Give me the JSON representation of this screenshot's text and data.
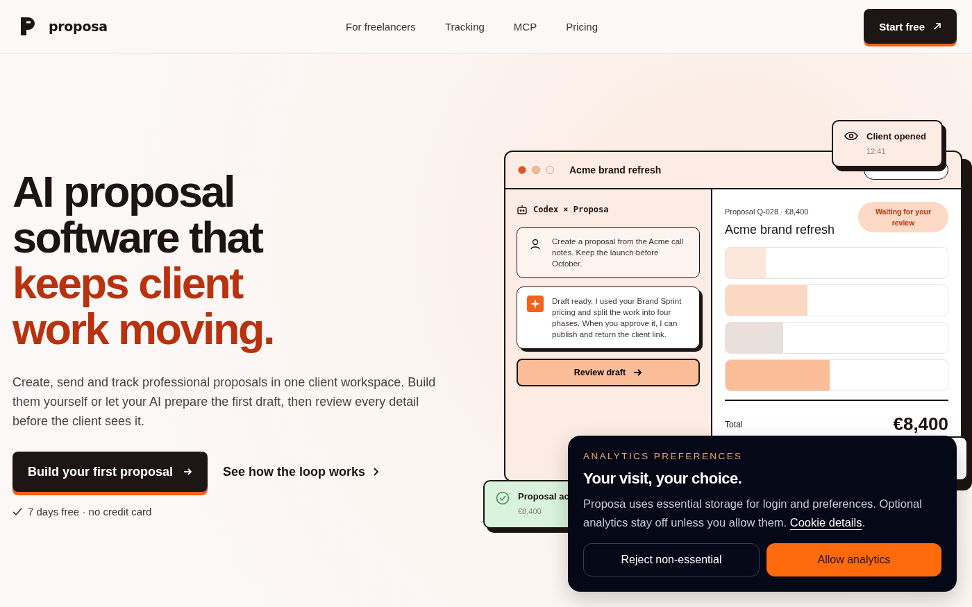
{
  "brand": {
    "name": "proposa"
  },
  "nav": [
    "For freelancers",
    "Tracking",
    "MCP",
    "Pricing"
  ],
  "header_cta": {
    "label": "Start free"
  },
  "hero": {
    "heading_lines": [
      {
        "text": "AI proposal",
        "accent": false
      },
      {
        "text": "software that",
        "accent": false
      },
      {
        "text": "keeps client",
        "accent": true
      },
      {
        "text": "work moving.",
        "accent": true
      }
    ],
    "description": "Create, send and track professional proposals in one client workspace. Build them yourself or let your AI prepare the first draft, then review every detail before the client sees it.",
    "primary_button": "Build your first proposal",
    "secondary_link": "See how the loop works",
    "note": "7 days free · no credit card"
  },
  "mockup": {
    "window_title": "Acme brand refresh",
    "traffic_lights": [
      {
        "color": "#e0541c"
      },
      {
        "color": "#f4b894"
      },
      {
        "color": "#fbe7dc"
      }
    ],
    "chat_header": "Codex × Proposa",
    "messages": [
      {
        "kind": "user",
        "text": "Create a proposal from the Acme call notes. Keep the launch before October."
      },
      {
        "kind": "assistant",
        "text": "Draft ready. I used your Brand Sprint pricing and split the work into four phases. When you approve it, I can publish and return the client link."
      }
    ],
    "review_button": "Review draft",
    "proposal_meta": "Proposal Q-028 · €8,400",
    "proposal_title": "Acme brand refresh",
    "status_badge": "Waiting for your review",
    "line_items": [
      {
        "level": 0.18,
        "color": "#fde6da"
      },
      {
        "level": 0.37,
        "color": "#fcd7c2"
      },
      {
        "level": 0.26,
        "color": "#e9e0db"
      },
      {
        "level": 0.47,
        "color": "#fbbd98"
      }
    ],
    "total_label": "Total",
    "total_value": "€8,400",
    "client_card": {
      "title": "Client opened",
      "time": "12:41"
    },
    "accepted_card": {
      "title": "Proposal ac",
      "amount": "€8,400"
    }
  },
  "cookie_banner": {
    "eyebrow": "ANALYTICS PREFERENCES",
    "title": "Your visit, your choice.",
    "text": "Proposa uses essential storage for login and preferences. Optional analytics stay off unless you allow them.",
    "link": "Cookie details",
    "text_end": ".",
    "buttons": [
      {
        "label": "Reject non-essential",
        "kind": "secondary"
      },
      {
        "label": "Allow analytics",
        "kind": "primary"
      }
    ]
  }
}
